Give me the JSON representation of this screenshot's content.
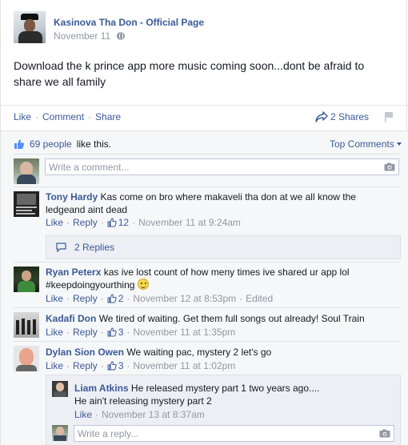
{
  "post": {
    "page_name": "Kasinova Tha Don - Official Page",
    "date": "November 11",
    "text": "Download the k prince app more music coming soon...dont be afraid to share we all family",
    "like_label": "Like",
    "comment_label": "Comment",
    "share_label": "Share",
    "sep": "·",
    "shares_label": "2 Shares"
  },
  "likes": {
    "count_label": "69 people",
    "suffix": "like this.",
    "top_comments_label": "Top Comments"
  },
  "composer": {
    "placeholder": "Write a comment..."
  },
  "comments": [
    {
      "author": "Tony Hardy",
      "text": "Kas come on bro where makaveli tha don at we all know the ledgeand aint dead",
      "like": "Like",
      "reply": "Reply",
      "likes": "12",
      "timestamp": "November 11 at 9:24am"
    },
    {
      "author": "Ryan Peterx",
      "text": "kas ive lost count of how meny times ive shared ur app lol #keepdoingyourthing",
      "like": "Like",
      "reply": "Reply",
      "likes": "2",
      "timestamp": "November 12 at 8:53pm",
      "edited": "Edited"
    },
    {
      "author": "Kadafi Don",
      "text": "We tired of waiting. Get them full songs out already! Soul Train",
      "like": "Like",
      "reply": "Reply",
      "likes": "3",
      "timestamp": "November 11 at 1:35pm"
    },
    {
      "author": "Dylan Sion Owen",
      "text": "We waiting pac, mystery 2 let's go",
      "like": "Like",
      "reply": "Reply",
      "likes": "3",
      "timestamp": "November 11 at 1:02pm"
    }
  ],
  "replies_toggle": "2 Replies",
  "nested_reply": {
    "author": "Liam Atkins",
    "line1": "He released mystery part 1 two years ago....",
    "line2": "He ain't releasing mystery part 2",
    "like": "Like",
    "timestamp": "November 13 at 8:37am"
  },
  "reply_composer": {
    "placeholder": "Write a reply..."
  },
  "colors": {
    "link": "#3b5998",
    "meta": "#9197a3",
    "ufi_bg": "#f6f7f8"
  }
}
